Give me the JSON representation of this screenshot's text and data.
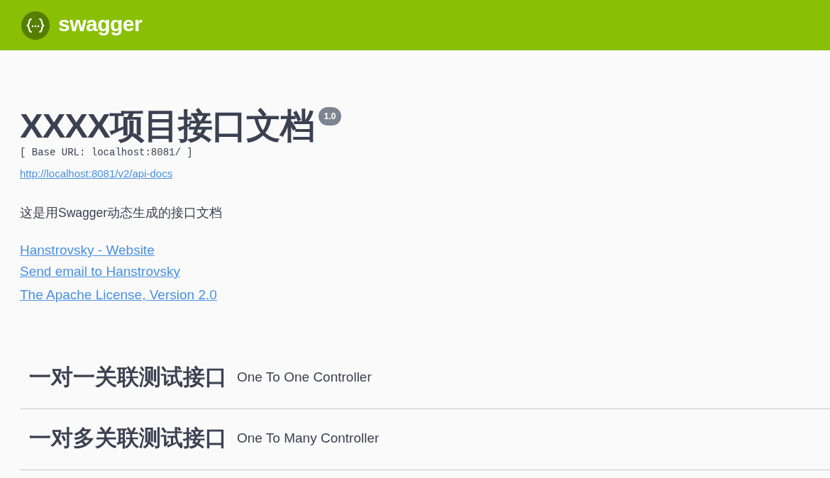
{
  "topbar": {
    "brand": "swagger"
  },
  "info": {
    "title": "XXXX项目接口文档",
    "version": "1.0",
    "base_url": "[ Base URL: localhost:8081/ ]",
    "spec_url": "http://localhost:8081/v2/api-docs",
    "description": "这是用Swagger动态生成的接口文档",
    "contact_links": [
      "Hanstrovsky - Website",
      "Send email to Hanstrovsky"
    ],
    "license": "The Apache License, Version 2.0"
  },
  "tags": [
    {
      "name": "一对一关联测试接口",
      "description": "One To One Controller"
    },
    {
      "name": "一对多关联测试接口",
      "description": "One To Many Controller"
    }
  ]
}
